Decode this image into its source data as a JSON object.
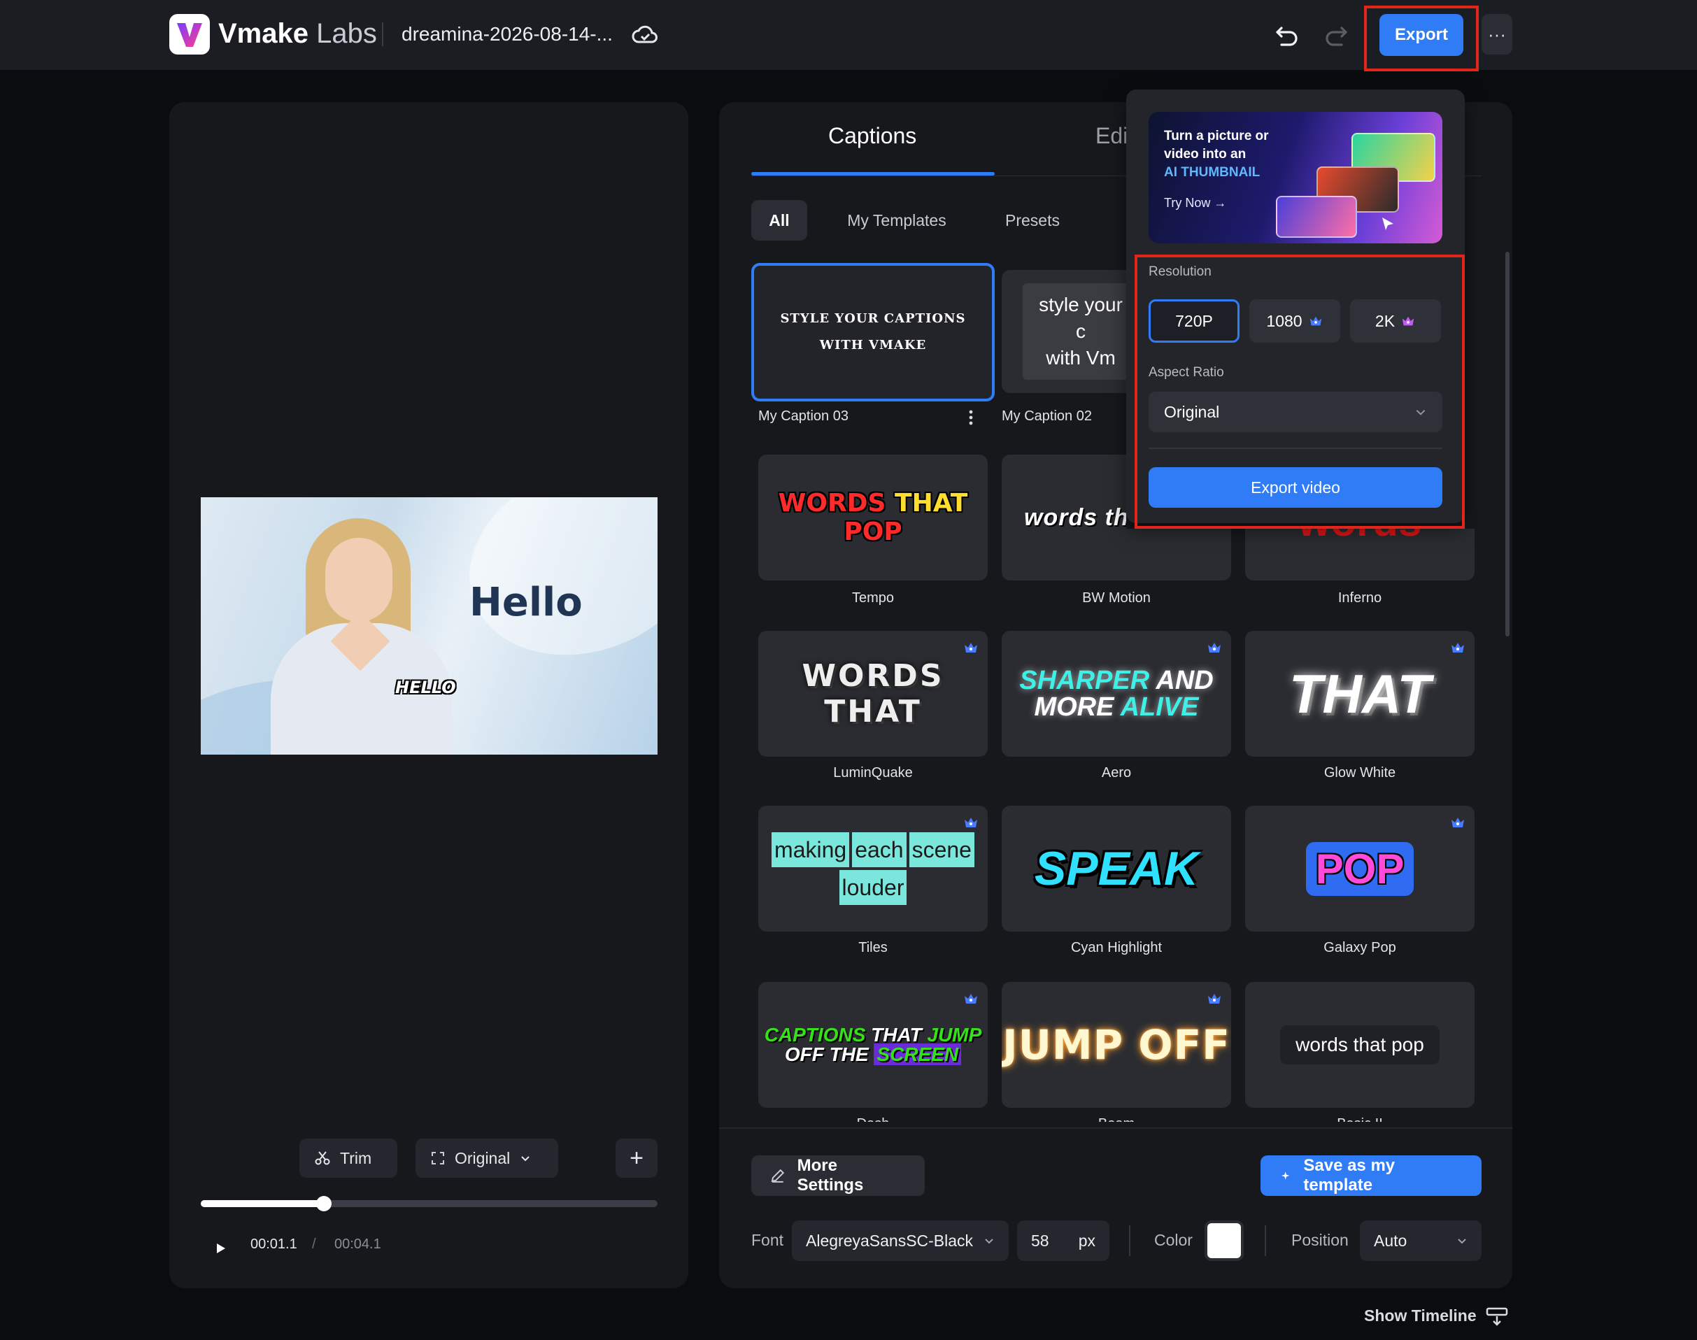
{
  "header": {
    "brand_bold": "Vmake",
    "brand_light": "Labs",
    "doc_title": "dreamina-2026-08-14-...",
    "export_label": "Export",
    "more_label": "···"
  },
  "preview": {
    "overlay_big": "Hello",
    "overlay_small": "HELLO",
    "trim_label": "Trim",
    "ratio_label": "Original",
    "add_label": "+",
    "time_current": "00:01.1",
    "time_separator": "/",
    "time_total": "00:04.1",
    "progress_fraction": 0.27
  },
  "tabs": {
    "captions": "Captions",
    "edit": "Edi"
  },
  "filters": {
    "all": "All",
    "my_templates": "My Templates",
    "presets": "Presets"
  },
  "templates": [
    {
      "name": "My Caption 03",
      "sample_line1": "STYLE YOUR CAPTIONS",
      "sample_line2": "WITH VMAKE",
      "premium": false
    },
    {
      "name": "My Caption 02",
      "sample_line1": "style your c",
      "sample_line2": "with Vm",
      "premium": false
    },
    {
      "name": "Tempo",
      "sample_a": "WORDS",
      "sample_b": "THAT",
      "sample_c": "POP",
      "premium": false
    },
    {
      "name": "BW Motion",
      "sample": "words th",
      "premium": false
    },
    {
      "name": "Inferno",
      "sample": "words",
      "premium": false
    },
    {
      "name": "LuminQuake",
      "sample": "WORDS THAT",
      "premium": true
    },
    {
      "name": "Aero",
      "sample_line1a": "SHARPER",
      "sample_line1b": "AND",
      "sample_line2a": "MORE",
      "sample_line2b": "ALIVE",
      "premium": true
    },
    {
      "name": "Glow White",
      "sample": "THAT",
      "premium": true
    },
    {
      "name": "Tiles",
      "sample_w1": "making",
      "sample_w2": "each",
      "sample_w3": "scene",
      "sample_w4": "louder",
      "premium": true
    },
    {
      "name": "Cyan Highlight",
      "sample": "SPEAK",
      "premium": false
    },
    {
      "name": "Galaxy Pop",
      "sample": "POP",
      "premium": true
    },
    {
      "name": "Dash",
      "sample_a": "CAPTIONS",
      "sample_b": "THAT",
      "sample_c": "JUMP",
      "sample_d": "OFF THE",
      "sample_e": "SCREEN",
      "premium": true
    },
    {
      "name": "Beam",
      "sample": "JUMP OFF",
      "premium": true
    },
    {
      "name": "Basic II",
      "sample": "words that pop",
      "premium": false
    }
  ],
  "footer": {
    "more_settings": "More Settings",
    "save_template": "Save as my template",
    "font_label": "Font",
    "font_value": "AlegreyaSansSC-Black",
    "size_value": "58",
    "size_unit": "px",
    "color_label": "Color",
    "color_value": "#ffffff",
    "position_label": "Position",
    "position_value": "Auto",
    "show_timeline": "Show Timeline"
  },
  "export_popover": {
    "banner_line1": "Turn a picture or",
    "banner_line2": "video into an",
    "banner_highlight": "AI THUMBNAIL",
    "banner_cta": "Try Now →",
    "resolution_label": "Resolution",
    "resolutions": [
      {
        "label": "720P",
        "selected": true,
        "premium": false
      },
      {
        "label": "1080",
        "selected": false,
        "premium": true
      },
      {
        "label": "2K",
        "selected": false,
        "premium": true
      }
    ],
    "aspect_ratio_label": "Aspect Ratio",
    "aspect_ratio_value": "Original",
    "export_video_label": "Export video"
  },
  "colors": {
    "accent": "#2f7cf6",
    "highlight_box": "#e1251b",
    "panel": "#16181c",
    "topbar": "#1b1d22"
  }
}
